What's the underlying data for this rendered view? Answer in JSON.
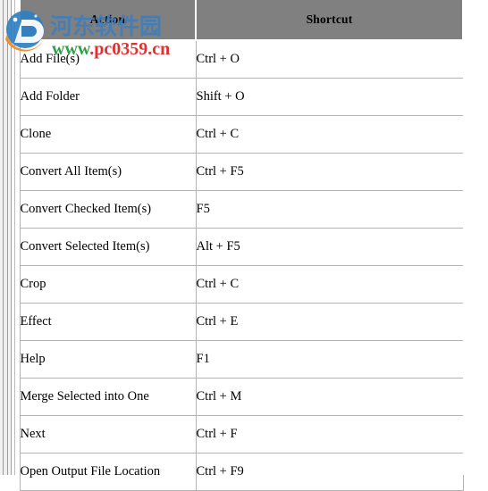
{
  "table": {
    "columns": [
      "Action",
      "Shortcut"
    ],
    "rows": [
      {
        "action": "Add File(s)",
        "shortcut": "Ctrl + O"
      },
      {
        "action": "Add Folder",
        "shortcut": "Shift + O"
      },
      {
        "action": "Clone",
        "shortcut": "Ctrl + C"
      },
      {
        "action": "Convert All Item(s)",
        "shortcut": "Ctrl + F5"
      },
      {
        "action": "Convert Checked Item(s)",
        "shortcut": "F5"
      },
      {
        "action": "Convert Selected Item(s)",
        "shortcut": "Alt + F5"
      },
      {
        "action": "Crop",
        "shortcut": "Ctrl + C"
      },
      {
        "action": "Effect",
        "shortcut": "Ctrl + E"
      },
      {
        "action": "Help",
        "shortcut": "F1"
      },
      {
        "action": "Merge Selected into One",
        "shortcut": "Ctrl + M"
      },
      {
        "action": "Next",
        "shortcut": "Ctrl + F"
      },
      {
        "action": "Open Output File Location",
        "shortcut": "Ctrl + F9"
      }
    ]
  },
  "watermark": {
    "logo_icon": "circular-site-logo-icon",
    "site_name": "河东软件园",
    "url_prefix": "www",
    "url_domain": ".pc0359.cn",
    "site_name_color": "#3d7ebf",
    "url_prefix_color": "#2f9e44",
    "url_domain_color": "#e03131",
    "logo_blue": "#2f7fc1",
    "logo_orange": "#ef8b2c"
  },
  "colors": {
    "header_background": "#808080",
    "header_text": "#000000",
    "cell_border": "#b3b3b3",
    "cell_background": "#ffffff",
    "page_background": "#ffffff"
  }
}
